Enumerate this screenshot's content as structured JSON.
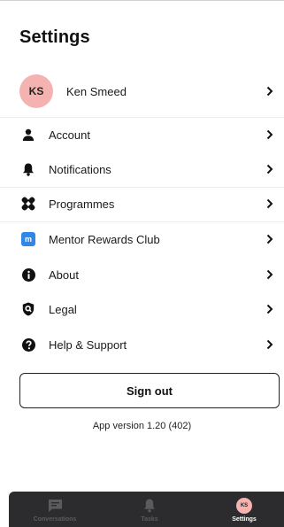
{
  "header": {
    "title": "Settings"
  },
  "profile": {
    "initials": "KS",
    "name": "Ken Smeed"
  },
  "menu": {
    "account": "Account",
    "notifications": "Notifications",
    "programmes": "Programmes",
    "rewards": "Mentor Rewards Club",
    "rewards_badge": "m",
    "about": "About",
    "legal": "Legal",
    "help": "Help & Support"
  },
  "actions": {
    "sign_out": "Sign out"
  },
  "footer": {
    "version": "App version 1.20 (402)"
  },
  "tabbar": {
    "conversations": "Conversations",
    "tasks": "Tasks",
    "settings": "Settings",
    "settings_initials": "KS",
    "active": "settings"
  },
  "colors": {
    "avatar": "#f4b3b0",
    "tabbar_bg": "#2c2c2e",
    "rewards_blue": "#2f88e8"
  }
}
